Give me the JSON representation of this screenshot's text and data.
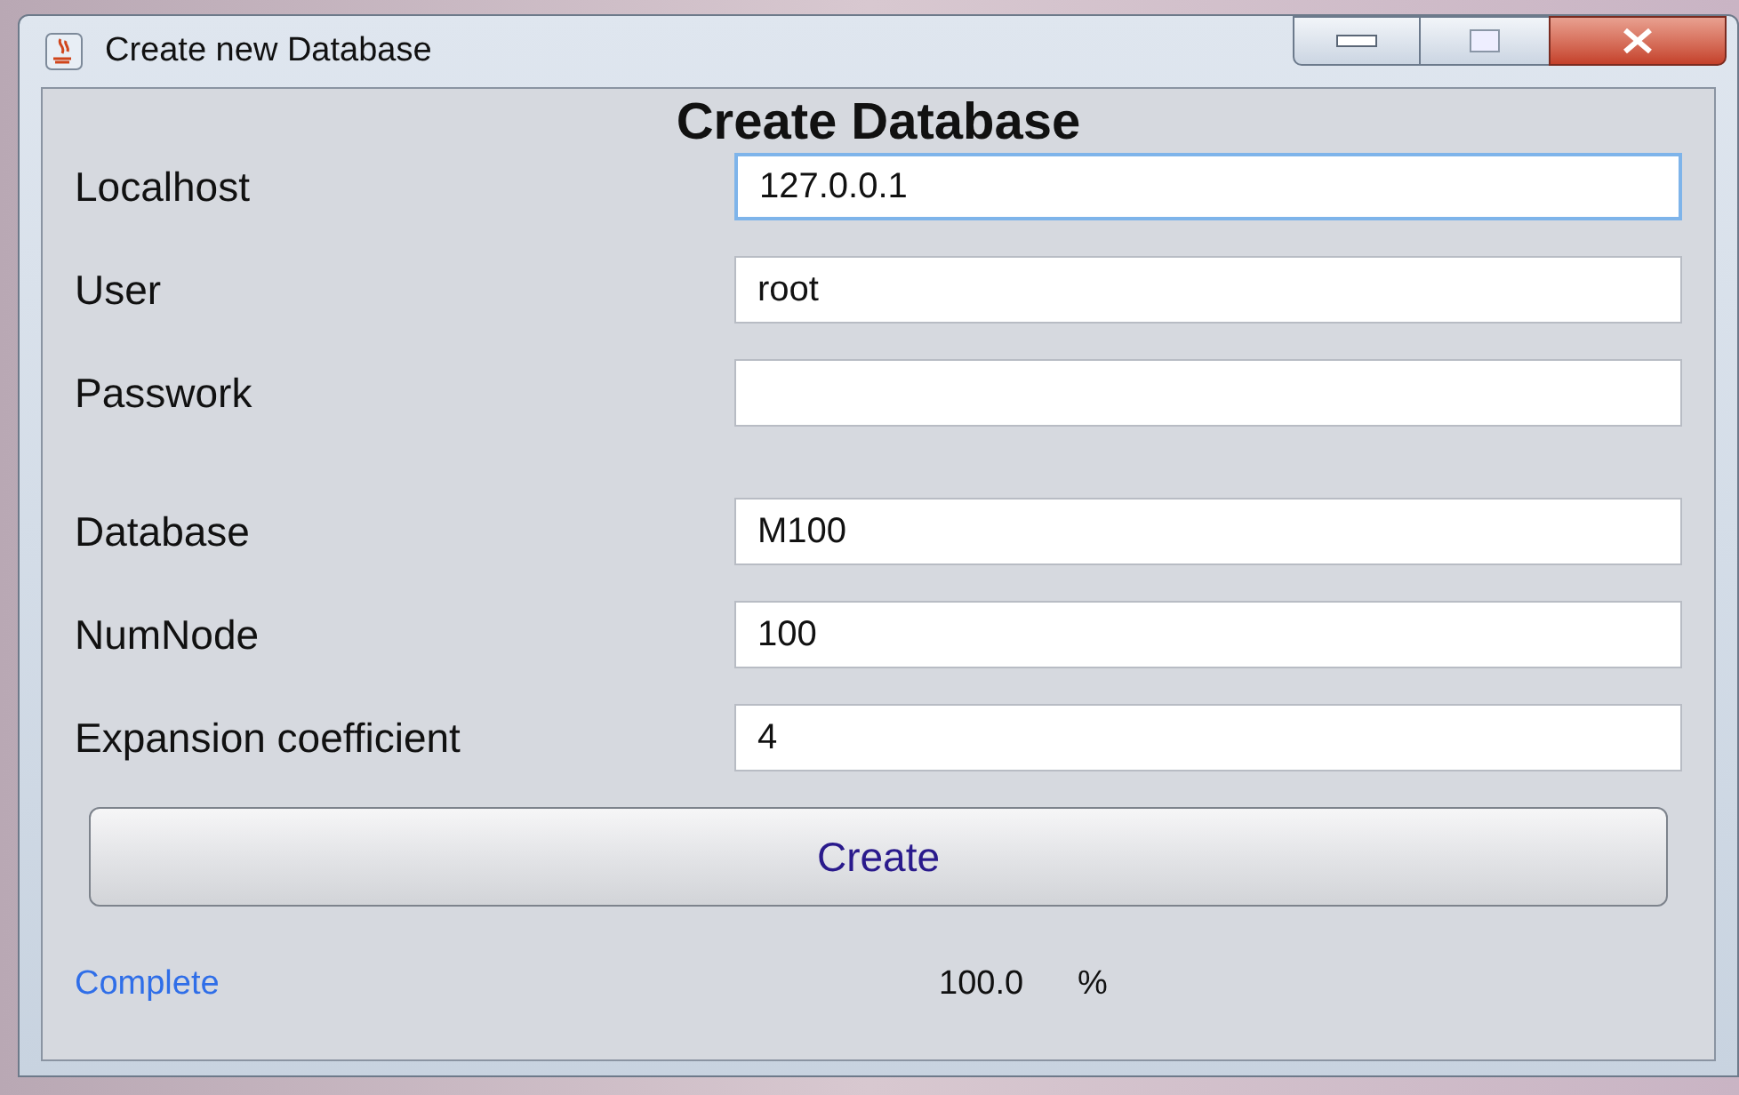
{
  "window": {
    "title": "Create new Database"
  },
  "heading": "Create Database",
  "fields": [
    {
      "label": "Localhost",
      "value": "127.0.0.1",
      "focused": true
    },
    {
      "label": "User",
      "value": "root",
      "focused": false
    },
    {
      "label": "Passwork",
      "focused": false
    },
    {
      "label": "Database",
      "value": "M100",
      "focused": false
    },
    {
      "label": "NumNode",
      "value": "100",
      "focused": false
    },
    {
      "label": "Expansion coefficient",
      "value": "4",
      "focused": false
    }
  ],
  "create_button": "Create",
  "status": {
    "message": "Complete",
    "progress": "100.0",
    "unit": "%"
  }
}
